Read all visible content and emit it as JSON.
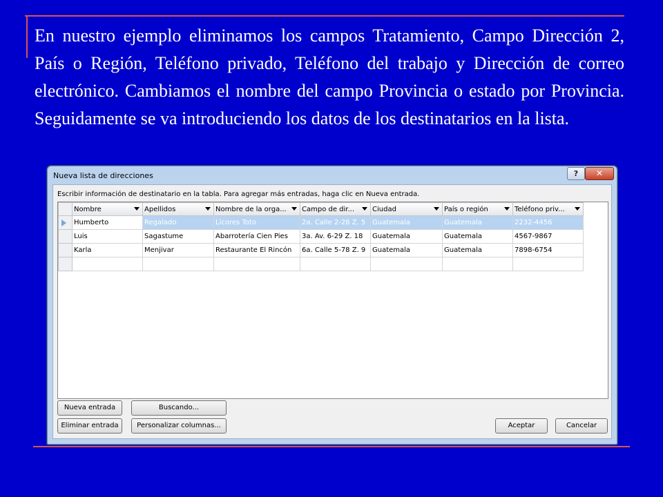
{
  "slide": {
    "text": "En nuestro ejemplo eliminamos los campos Tratamiento, Campo Dirección 2, País o Región, Teléfono privado, Teléfono del trabajo y Dirección de correo electrónico. Cambiamos el nombre del campo Provincia o estado por Provincia. Seguidamente se va introduciendo los datos de los destinatarios en la lista."
  },
  "dialog": {
    "title": "Nueva lista de direcciones",
    "help_label": "?",
    "close_label": "✕",
    "instruction": "Escribir información de destinatario en la tabla. Para agregar más entradas, haga clic en Nueva entrada.",
    "columns": [
      "Nombre",
      "Apellidos",
      "Nombre de la orga...",
      "Campo de dir...",
      "Ciudad",
      "País o región",
      "Teléfono priv..."
    ],
    "rows": [
      [
        "Humberto",
        "Regalado",
        "Licores Toto",
        "2a. Calle 2-28 Z. 5",
        "Guatemala",
        "Guatemala",
        "2232-4456"
      ],
      [
        "Luis",
        "Sagastume",
        "Abarrotería Cien Pies",
        "3a. Av. 6-29 Z. 18",
        "Guatemala",
        "Guatemala",
        "4567-9867"
      ],
      [
        "Karla",
        "Menjivar",
        "Restaurante El Rincón",
        "6a. Calle 5-78 Z. 9",
        "Guatemala",
        "Guatemala",
        "7898-6754"
      ]
    ],
    "buttons": {
      "new_entry": "Nueva entrada",
      "search": "Buscando...",
      "delete_entry": "Eliminar entrada",
      "customize_columns": "Personalizar columnas...",
      "accept": "Aceptar",
      "cancel": "Cancelar"
    }
  }
}
